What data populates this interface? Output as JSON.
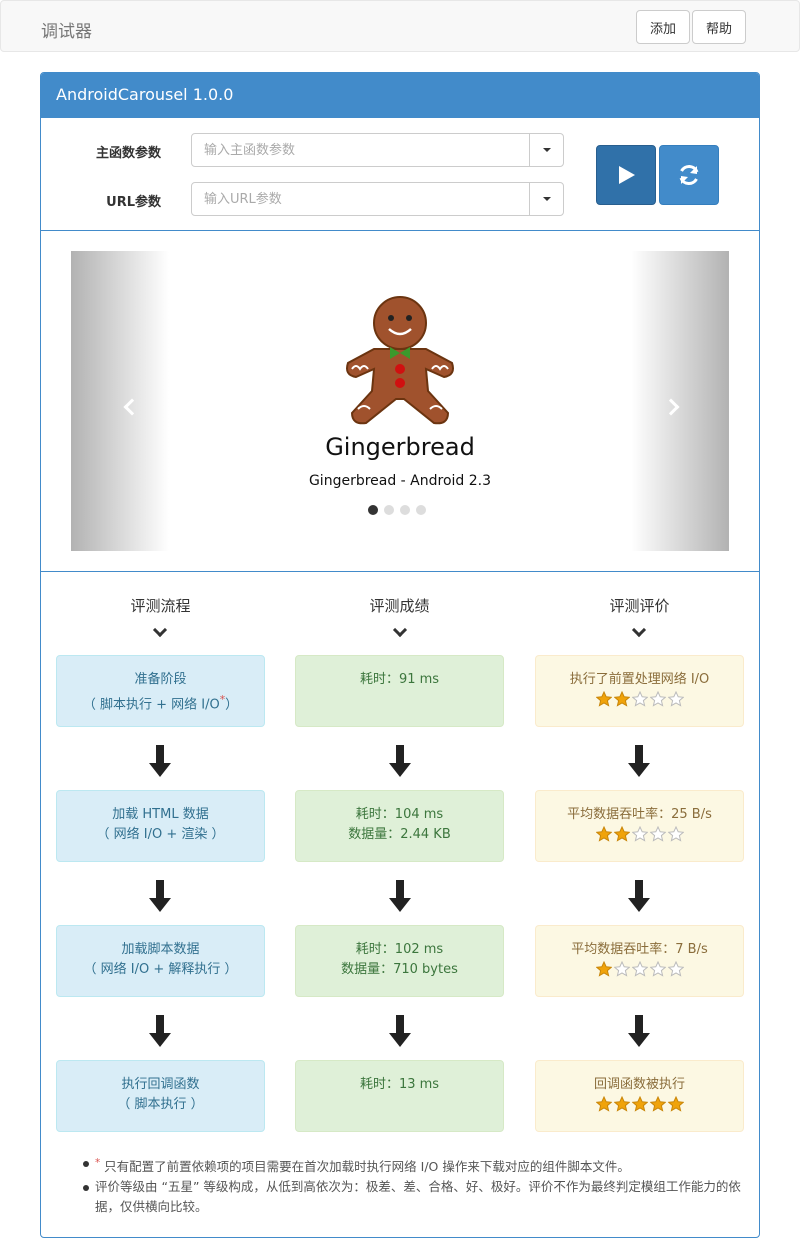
{
  "navbar": {
    "brand": "调试器",
    "add_label": "添加",
    "help_label": "帮助"
  },
  "panel": {
    "title": "AndroidCarousel 1.0.0",
    "main_params": {
      "label": "主函数参数",
      "placeholder": "输入主函数参数",
      "value": ""
    },
    "url_params": {
      "label": "URL参数",
      "placeholder": "输入URL参数",
      "value": ""
    },
    "run_icon": "play-icon",
    "refresh_icon": "refresh-icon"
  },
  "carousel": {
    "title": "Gingerbread",
    "caption": "Gingerbread - Android 2.3",
    "slide_count": 4,
    "active_index": 0
  },
  "evaluation": {
    "headers": [
      "评测流程",
      "评测成绩",
      "评测评价"
    ],
    "rows": [
      {
        "stage": [
          "准备阶段",
          "（ 脚本执行 + 网络 I/O",
          "）"
        ],
        "result": [
          "耗时：91 ms"
        ],
        "rating_text": "执行了前置处理网络 I/O",
        "stars": 2
      },
      {
        "stage": [
          "加载 HTML 数据",
          "（ 网络 I/O + 渲染 ）"
        ],
        "result": [
          "耗时：104 ms",
          "数据量：2.44 KB"
        ],
        "rating_text": "平均数据吞吐率：25 B/s",
        "stars": 2
      },
      {
        "stage": [
          "加载脚本数据",
          "（ 网络 I/O + 解释执行 ）"
        ],
        "result": [
          "耗时：102 ms",
          "数据量：710 bytes"
        ],
        "rating_text": "平均数据吞吐率：7 B/s",
        "stars": 1
      },
      {
        "stage": [
          "执行回调函数",
          "（ 脚本执行 ）"
        ],
        "result": [
          "耗时：13 ms"
        ],
        "rating_text": "回调函数被执行",
        "stars": 5
      }
    ]
  },
  "notes": {
    "asterisk": "*",
    "note1": " 只有配置了前置依赖项的项目需要在首次加载时执行网络 I/O 操作来下载对应的组件脚本文件。",
    "note2": "评价等级由 “五星” 等级构成，从低到高依次为：极差、差、合格、好、极好。评价不作为最终判定模组工作能力的依据，仅供横向比较。"
  },
  "colors": {
    "primary": "#428bca",
    "primary_dark": "#2a6496",
    "star_gold": "#f0a30a",
    "star_empty": "#dddddd"
  }
}
